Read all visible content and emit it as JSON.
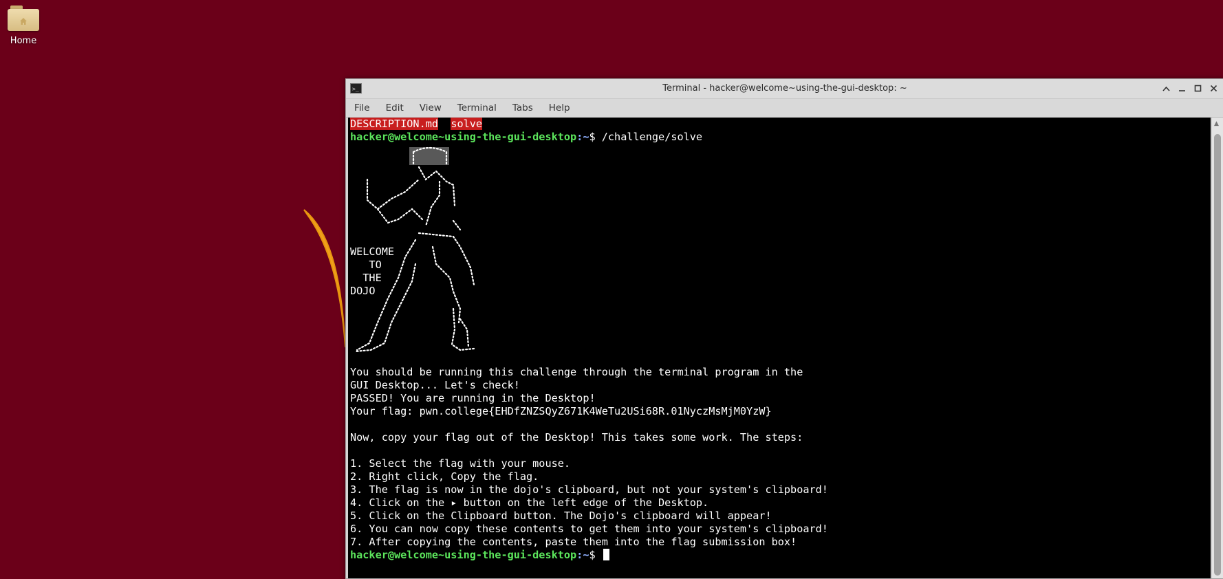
{
  "desktop": {
    "icons": [
      {
        "label": "Home",
        "icon": "home-folder-icon"
      }
    ],
    "background_color": "#6b0019"
  },
  "window": {
    "title": "Terminal - hacker@welcome~using-the-gui-desktop: ~",
    "menu": [
      "File",
      "Edit",
      "View",
      "Terminal",
      "Tabs",
      "Help"
    ]
  },
  "terminal": {
    "ls_items": [
      "DESCRIPTION.md",
      "solve"
    ],
    "prompt_user": "hacker@welcome~using-the-gui-desktop",
    "prompt_path": ":~",
    "prompt_symbol": "$ ",
    "command": "/challenge/solve",
    "ascii_labels": [
      "WELCOME",
      "   TO",
      "  THE",
      "DOJO"
    ],
    "output": [
      "You should be running this challenge through the terminal program in the",
      "GUI Desktop... Let's check!",
      "PASSED! You are running in the Desktop!",
      "Your flag: pwn.college{EHDfZNZSQyZ671K4WeTu2USi68R.01NyczMsMjM0YzW}",
      "",
      "Now, copy your flag out of the Desktop! This takes some work. The steps:",
      "",
      "1. Select the flag with your mouse.",
      "2. Right click, Copy the flag.",
      "3. The flag is now in the dojo's clipboard, but not your system's clipboard!",
      "4. Click on the ▸ button on the left edge of the Desktop.",
      "5. Click on the Clipboard button. The Dojo's clipboard will appear!",
      "6. You can now copy these contents to get them into your system's clipboard!",
      "7. After copying the contents, paste them into the flag submission box!"
    ]
  },
  "colors": {
    "prompt_user": "#5ce65c",
    "prompt_path": "#8fb0ff",
    "ls_highlight": "#c81e1e"
  }
}
